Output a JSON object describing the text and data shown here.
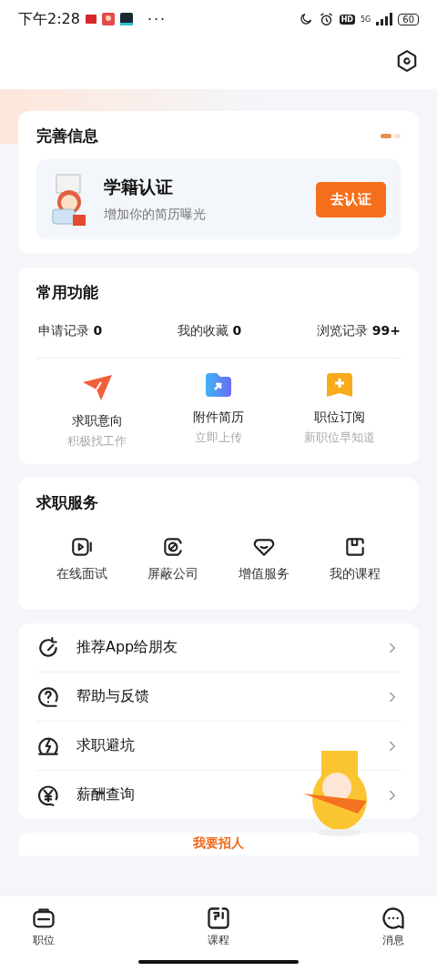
{
  "status_bar": {
    "time": "下午2:28",
    "more": "···",
    "hd": "HD",
    "network": "5G",
    "battery": "60"
  },
  "complete_info": {
    "title": "完善信息",
    "pager_dots": [
      {
        "selected": true
      },
      {
        "selected": false
      }
    ],
    "card": {
      "title": "学籍认证",
      "subtitle": "增加你的简历曝光",
      "button": "去认证"
    }
  },
  "common_functions": {
    "title": "常用功能",
    "stats": [
      {
        "label": "申请记录",
        "value": "0"
      },
      {
        "label": "我的收藏",
        "value": "0"
      },
      {
        "label": "浏览记录",
        "value": "99+"
      }
    ],
    "features": [
      {
        "kind": "send",
        "label": "求职意向",
        "sub": "积极找工作"
      },
      {
        "kind": "folder",
        "label": "附件简历",
        "sub": "立即上传"
      },
      {
        "kind": "bookmark",
        "label": "职位订阅",
        "sub": "新职位早知道"
      }
    ]
  },
  "job_services": {
    "title": "求职服务",
    "items": [
      {
        "kind": "video",
        "label": "在线面试"
      },
      {
        "kind": "block",
        "label": "屏蔽公司"
      },
      {
        "kind": "heart",
        "label": "增值服务"
      },
      {
        "kind": "book",
        "label": "我的课程"
      }
    ]
  },
  "menu": [
    {
      "kind": "share",
      "label": "推荐App给朋友"
    },
    {
      "kind": "help",
      "label": "帮助与反馈"
    },
    {
      "kind": "bolt",
      "label": "求职避坑"
    },
    {
      "kind": "yen",
      "label": "薪酬查询"
    }
  ],
  "recruit_link": "我要招人",
  "bottom_nav": [
    {
      "kind": "bag",
      "label": "职位"
    },
    {
      "kind": "course",
      "label": "课程"
    },
    {
      "kind": "chat",
      "label": "消息"
    }
  ]
}
